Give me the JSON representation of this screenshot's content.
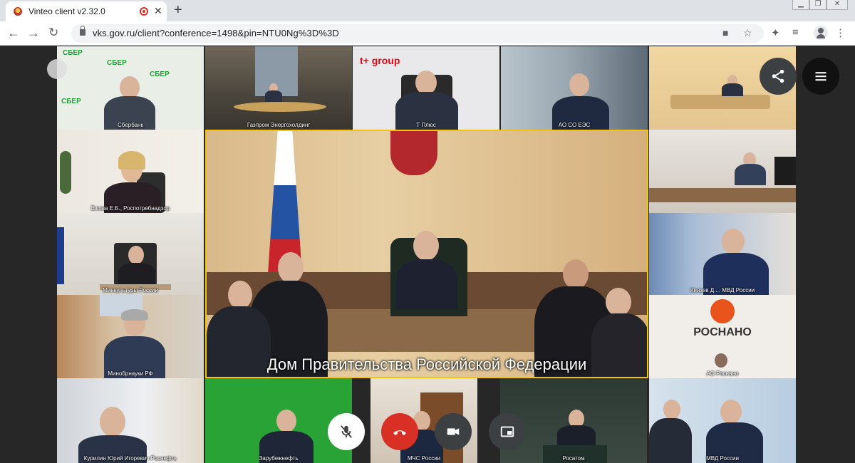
{
  "browser": {
    "tab_title": "Vinteo client v2.32.0",
    "new_tab_icon": "plus-icon",
    "url": "vks.gov.ru/client?conference=1498&pin=NTU0Ng%3D%3D"
  },
  "conference": {
    "main_speaker_label": "Дом Правительства Российской Федерации",
    "participants": [
      {
        "label": "Сбербанк"
      },
      {
        "label": "Газпром Энергохолдинг"
      },
      {
        "label": "Т Плюс"
      },
      {
        "label": "АО СО ЕЭС"
      },
      {
        "label": "Ежова Е.Б., Роспотребнадзор"
      },
      {
        "label": "Минкультуры России"
      },
      {
        "label": "Минобрнауки РФ"
      },
      {
        "label": "Князев Д.... МВД России"
      },
      {
        "label": "АО Роснано"
      },
      {
        "label": "Курилин Юрий Игоревич Роснефть"
      },
      {
        "label": "Зарубежнефть"
      },
      {
        "label": "МЧС России"
      },
      {
        "label": "Росатом"
      },
      {
        "label": "МВД России"
      }
    ],
    "logos": {
      "sber": "СБЕР",
      "tplus": "t+ group",
      "rosnano": "РОСНАНО"
    }
  },
  "controls": {
    "mute_icon": "mic-off-icon",
    "hangup_icon": "hangup-icon",
    "camera_icon": "camera-icon",
    "pip_icon": "picture-in-picture-icon",
    "share_icon": "share-icon",
    "menu_icon": "menu-icon"
  }
}
